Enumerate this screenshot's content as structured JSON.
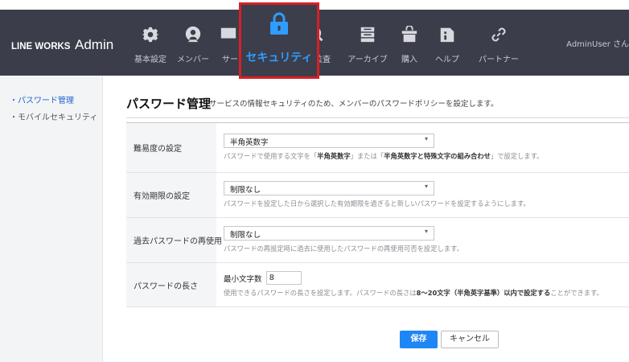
{
  "header": {
    "brand": "LINE WORKS",
    "product": "Admin",
    "nav": [
      {
        "label": "基本設定",
        "icon": "gear-icon"
      },
      {
        "label": "メンバー",
        "icon": "member-icon"
      },
      {
        "label": "サービ",
        "icon": "service-icon"
      },
      {
        "label": "監査",
        "icon": "audit-icon"
      },
      {
        "label": "アーカイブ",
        "icon": "archive-icon"
      },
      {
        "label": "購入",
        "icon": "purchase-icon"
      },
      {
        "label": "ヘルプ",
        "icon": "help-icon"
      },
      {
        "label": "パートナー",
        "icon": "partner-icon"
      }
    ],
    "active_nav": {
      "label": "セキュリティ",
      "icon": "lock-icon"
    },
    "user": "AdminUser さん"
  },
  "sidebar": {
    "items": [
      {
        "label": "パスワード管理",
        "active": true
      },
      {
        "label": "モバイルセキュリティ",
        "active": false
      }
    ]
  },
  "page": {
    "title": "パスワード管理",
    "description": "サービスの情報セキュリティのため、メンバーのパスワードポリシーを設定します。"
  },
  "settings": {
    "difficulty": {
      "label": "難易度の設定",
      "value": "半角英数字",
      "help_pre": "パスワードで使用する文字を「",
      "help_b1": "半角英数字",
      "help_mid": "」または「",
      "help_b2": "半角英数字と特殊文字の組み合わせ",
      "help_post": "」で設定します。"
    },
    "expiry": {
      "label": "有効期限の設定",
      "value": "制限なし",
      "help": "パスワードを設定した日から選択した有効期限を過ぎると新しいパスワードを設定するようにします。"
    },
    "reuse": {
      "label": "過去パスワードの再使用",
      "value": "制限なし",
      "help": "パスワードの再設定時に過去に使用したパスワードの再使用可否を設定します。"
    },
    "length": {
      "label": "パスワードの長さ",
      "min_label": "最小文字数",
      "min_value": "8",
      "help_pre": "使用できるパスワードの長さを設定します。パスワードの長さは",
      "help_b": "8～20文字（半角英字基準）以内で設定する",
      "help_post": "ことができます。"
    }
  },
  "actions": {
    "save": "保存",
    "cancel": "キャンセル"
  },
  "colors": {
    "header_bg": "#3b3e4a",
    "active_border": "#d81f26",
    "accent": "#1f86f5"
  }
}
